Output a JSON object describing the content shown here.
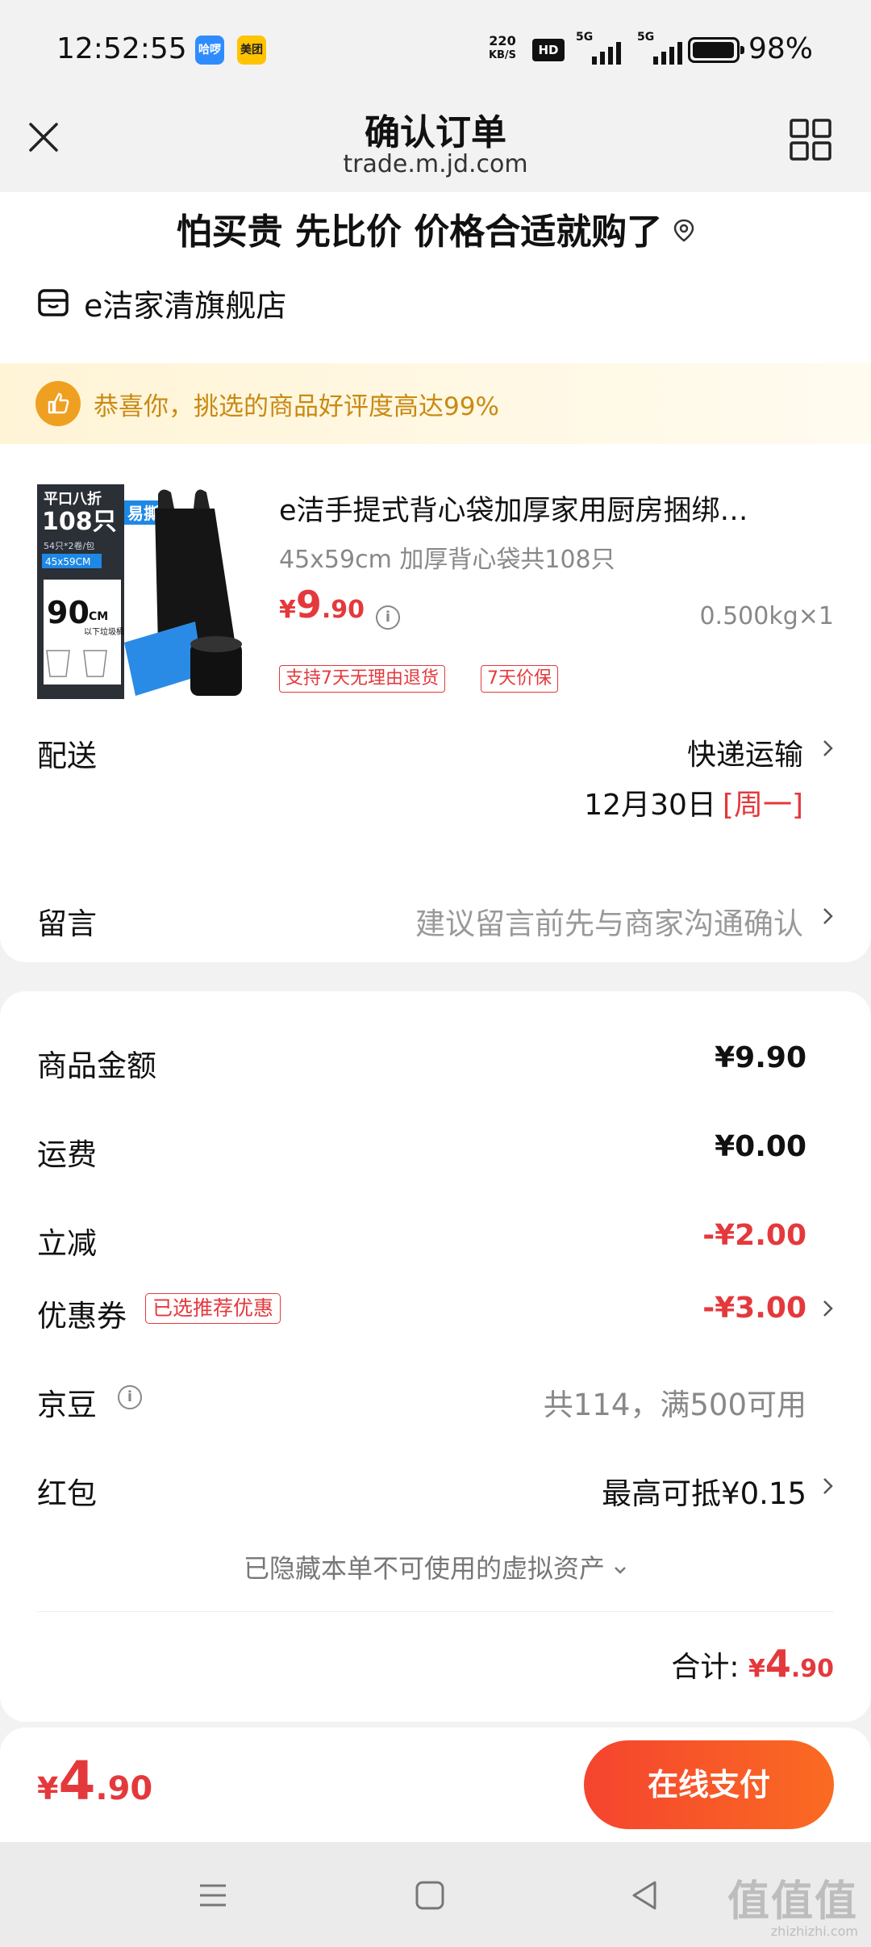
{
  "status_bar": {
    "time": "12:52:55",
    "app_badge_1": "哈啰",
    "app_badge_2": "美团",
    "net_speed_value": "220",
    "net_speed_unit": "KB/S",
    "hd_badge": "HD",
    "signal_1_label": "5G",
    "signal_2_label": "5G",
    "battery_percent": "98%",
    "battery_level": 0.98
  },
  "nav": {
    "title": "确认订单",
    "subtitle": "trade.m.jd.com",
    "close_icon": "close-icon",
    "menu_icon": "grid-icon"
  },
  "slogan": {
    "text": "怕买贵 先比价 价格合适就购了",
    "icon": "location-pin-icon"
  },
  "shop": {
    "name": "e洁家清旗舰店",
    "icon": "store-icon"
  },
  "rating_banner": {
    "text": "恭喜你，挑选的商品好评度高达99%",
    "icon": "thumbs-up-icon"
  },
  "product": {
    "title": "e洁手提式背心袋加厚家用厨房捆绑…",
    "spec": "45x59cm 加厚背心袋共108只",
    "price_currency": "¥",
    "price_int": "9",
    "price_dec": ".90",
    "weight_qty": "0.500kg×1",
    "tags": [
      "支持7天无理由退货",
      "7天价保"
    ],
    "image": {
      "badge_line1": "平口八折",
      "badge_line2": "108只",
      "tag_tear": "易撕",
      "size_line": "54只*2卷/包",
      "size_box": "45x59CM",
      "big_size": "90",
      "big_unit": "CM",
      "below_text": "以下垃圾桶"
    }
  },
  "delivery": {
    "label": "配送",
    "method": "快递运输",
    "date": "12月30日",
    "weekday": "[周一]"
  },
  "memo": {
    "label": "留言",
    "placeholder": "建议留言前先与商家沟通确认"
  },
  "summary": {
    "goods_amount_label": "商品金额",
    "goods_amount": "¥9.90",
    "shipping_label": "运费",
    "shipping": "¥0.00",
    "discount_label": "立减",
    "discount": "-¥2.00",
    "coupon_label": "优惠券",
    "coupon_tag": "已选推荐优惠",
    "coupon": "-¥3.00",
    "jingdou_label": "京豆",
    "jingdou_value": "共114，满500可用",
    "redpacket_label": "红包",
    "redpacket_value": "最高可抵¥0.15",
    "hidden_assets": "已隐藏本单不可使用的虚拟资产",
    "total_label": "合计:",
    "total_currency": "¥",
    "total_int": "4",
    "total_dec": ".90"
  },
  "pay": {
    "currency": "¥",
    "amount_int": "4",
    "amount_dec": ".90",
    "button": "在线支付"
  },
  "watermark": {
    "main": "值值值",
    "sub": "zhizhizhi.com"
  },
  "colors": {
    "accent_red": "#e4393c",
    "pay_gradient_start": "#f5442f",
    "pay_gradient_end": "#fa6b22",
    "banner_text": "#c98a12"
  }
}
